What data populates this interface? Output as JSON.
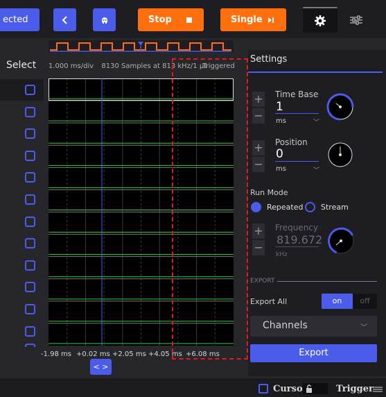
{
  "toolbar": {
    "connected_label": "ected",
    "stop_label": "Stop",
    "single_label": "Single",
    "back_icon": "chevron-left-icon",
    "app_icon": "robot-icon",
    "stop_icon": "square-icon",
    "single_icon": "step-forward-icon",
    "gear_icon": "gear-icon",
    "sliders_icon": "sliders-icon"
  },
  "select_column": {
    "label": "Select",
    "channel_count": 12
  },
  "info": {
    "time_per_div": "1.000 ms/div",
    "samples": "8130 Samples at 813 kHz/1 µs",
    "status": "Triggered"
  },
  "plot": {
    "x_ticks": [
      "-1.98 ms",
      "+0.02 ms",
      "+2.05 ms",
      "+4.05 ms",
      "+6.08 ms"
    ],
    "nav_label": "< >"
  },
  "settings": {
    "title": "Settings",
    "time_base": {
      "label": "Time Base",
      "value": "1",
      "unit": "ms"
    },
    "position": {
      "label": "Position",
      "value": "0",
      "unit": "ms"
    },
    "run_mode": {
      "label": "Run Mode",
      "options": [
        {
          "label": "Repeated",
          "selected": true
        },
        {
          "label": "Stream",
          "selected": false
        }
      ]
    },
    "frequency": {
      "label": "Frequency",
      "value": "819.672",
      "unit": "kHz"
    },
    "export_header": "EXPORT",
    "export_all": {
      "label": "Export All",
      "on_label": "on",
      "off_label": "off"
    },
    "channels_label": "Channels",
    "export_button": "Export"
  },
  "bottom": {
    "cursors_label": "Cursors",
    "trigger_label": "Trigger"
  },
  "colors": {
    "accent": "#4a5ce9",
    "orange": "#ff6f0e",
    "signal": "#2fd12f",
    "selection": "#e01b1b"
  }
}
